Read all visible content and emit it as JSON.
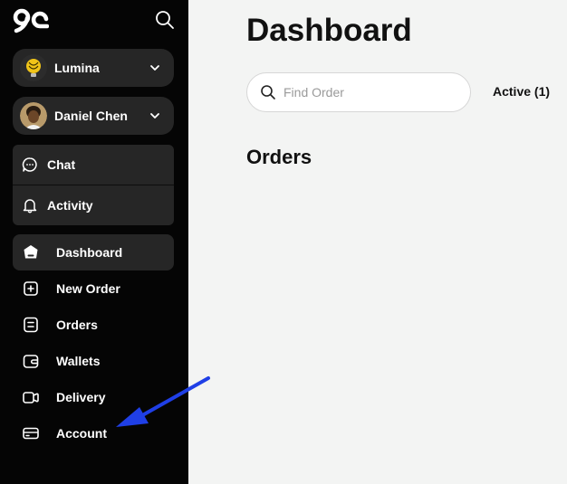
{
  "sidebar": {
    "workspace": {
      "label": "Lumina"
    },
    "user": {
      "label": "Daniel Chen"
    },
    "chat": {
      "label": "Chat"
    },
    "activity": {
      "label": "Activity"
    },
    "nav": [
      {
        "label": "Dashboard",
        "icon": "dashboard-icon",
        "active": true
      },
      {
        "label": "New Order",
        "icon": "new-order-icon"
      },
      {
        "label": "Orders",
        "icon": "orders-icon"
      },
      {
        "label": "Wallets",
        "icon": "wallet-icon"
      },
      {
        "label": "Delivery",
        "icon": "delivery-icon"
      },
      {
        "label": "Account",
        "icon": "account-card-icon"
      }
    ]
  },
  "main": {
    "title": "Dashboard",
    "search": {
      "placeholder": "Find Order",
      "value": ""
    },
    "tabs": [
      {
        "label": "Active (1)",
        "active": true
      }
    ],
    "orders_heading": "Orders"
  },
  "colors": {
    "sidebar_bg": "#050505",
    "sidebar_item_bg": "#262626",
    "main_bg": "#f3f4f3",
    "annotation_arrow": "#1f3fe6"
  }
}
